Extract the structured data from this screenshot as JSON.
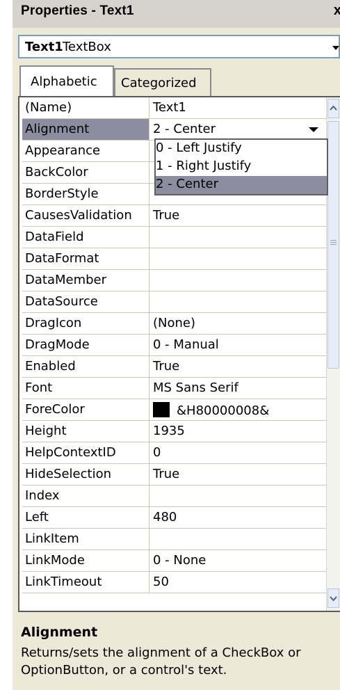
{
  "window": {
    "title": "Properties - Text1"
  },
  "object_selector": {
    "name": "Text1",
    "type": "TextBox"
  },
  "tabs": [
    {
      "label": "Alphabetic"
    },
    {
      "label": "Categorized"
    }
  ],
  "properties": [
    {
      "name": "(Name)",
      "value": "Text1"
    },
    {
      "name": "Alignment",
      "value": "2 - Center"
    },
    {
      "name": "Appearance",
      "value": ""
    },
    {
      "name": "BackColor",
      "value": ""
    },
    {
      "name": "BorderStyle",
      "value": ""
    },
    {
      "name": "CausesValidation",
      "value": "True"
    },
    {
      "name": "DataField",
      "value": ""
    },
    {
      "name": "DataFormat",
      "value": ""
    },
    {
      "name": "DataMember",
      "value": ""
    },
    {
      "name": "DataSource",
      "value": ""
    },
    {
      "name": "DragIcon",
      "value": "(None)"
    },
    {
      "name": "DragMode",
      "value": "0 - Manual"
    },
    {
      "name": "Enabled",
      "value": "True"
    },
    {
      "name": "Font",
      "value": "MS Sans Serif"
    },
    {
      "name": "ForeColor",
      "value": "&H80000008&"
    },
    {
      "name": "Height",
      "value": "1935"
    },
    {
      "name": "HelpContextID",
      "value": "0"
    },
    {
      "name": "HideSelection",
      "value": "True"
    },
    {
      "name": "Index",
      "value": ""
    },
    {
      "name": "Left",
      "value": "480"
    },
    {
      "name": "LinkItem",
      "value": ""
    },
    {
      "name": "LinkMode",
      "value": "0 - None"
    },
    {
      "name": "LinkTimeout",
      "value": "50"
    }
  ],
  "dropdown": {
    "options": [
      "0 - Left Justify",
      "1 - Right Justify",
      "2 - Center"
    ],
    "selected": "2 - Center"
  },
  "description": {
    "title": "Alignment",
    "text": "Returns/sets the alignment of a CheckBox or OptionButton, or a control's text."
  },
  "colors": {
    "selection": "#8c8ea0",
    "panel": "#ece9d8",
    "forecolor_swatch": "#000000"
  }
}
